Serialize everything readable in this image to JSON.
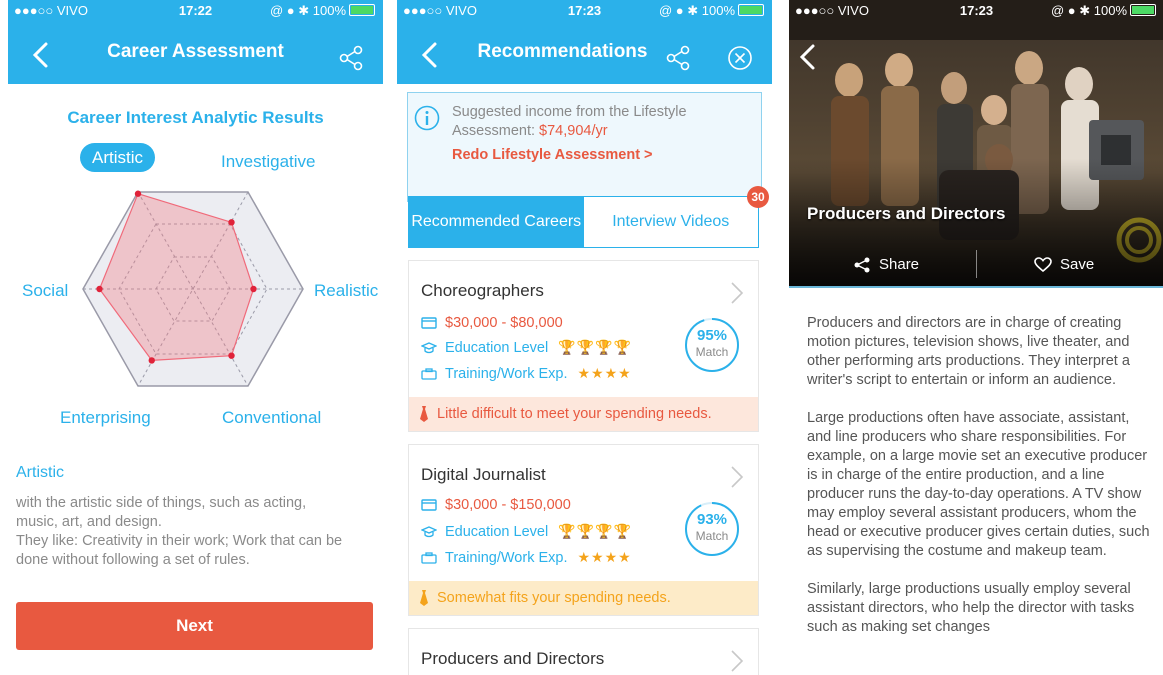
{
  "status1": {
    "carrier": "●●●○○ VIVO ",
    "time": "17:22",
    "battery": "100%"
  },
  "status2": {
    "carrier": "●●●○○ VIVO ",
    "time": "17:23",
    "battery": "100%"
  },
  "status3": {
    "carrier": "●●●○○ VIVO ",
    "time": "17:23",
    "battery": "100%"
  },
  "screen1": {
    "title": "Career Assessment",
    "heading": "Career Interest Analytic Results",
    "labels": {
      "artistic": "Artistic",
      "investigative": "Investigative",
      "realistic": "Realistic",
      "conventional": "Conventional",
      "enterprising": "Enterprising",
      "social": "Social"
    },
    "radar_values": {
      "artistic": 1.0,
      "investigative": 0.7,
      "realistic": 0.55,
      "conventional": 0.7,
      "enterprising": 0.75,
      "social": 0.85
    },
    "section_title": "Artistic",
    "description_line1": "with the artistic side of things, such as acting,",
    "description_line2": "music, art, and design.",
    "description_line3": "They like: Creativity in their work; Work that can be",
    "description_line4": "done without following a set of rules.",
    "next_label": "Next"
  },
  "screen2": {
    "title": "Recommendations",
    "info_line1": "Suggested income from the Lifestyle",
    "info_line2_prefix": "Assessment: ",
    "info_income": "$74,904/yr",
    "info_redo": "Redo Lifestyle Assessment >",
    "tab_active": "Recommended Careers",
    "tab_inactive": "Interview Videos",
    "badge": "30",
    "cards": [
      {
        "title": "Choreographers",
        "salary": "$30,000 - $80,000",
        "education": "Education Level",
        "training": "Training/Work Exp.",
        "match": "95%",
        "match_label": "Match",
        "match_value": 0.95,
        "fit": "Little difficult to meet your spending needs.",
        "trophies": 4,
        "stars": 4
      },
      {
        "title": "Digital Journalist",
        "salary": "$30,000 - $150,000",
        "education": "Education Level",
        "training": "Training/Work Exp.",
        "match": "93%",
        "match_label": "Match",
        "match_value": 0.93,
        "fit": "Somewhat fits your spending needs.",
        "trophies": 4,
        "stars": 4
      },
      {
        "title": "Producers and Directors"
      }
    ],
    "colors": {
      "accent": "#2bb1ea",
      "alert": "#e85940",
      "gold": "#f4a31b"
    }
  },
  "screen3": {
    "hero_title": "Producers and Directors",
    "share_label": "Share",
    "save_label": "Save",
    "para1": "Producers and directors are in charge of creating motion pictures, television shows, live theater, and other performing arts productions. They interpret a writer's script to entertain or inform an audience.",
    "para2": "Large productions often have associate, assistant, and line producers who share responsibilities. For example, on a large movie set an executive producer is in charge of the entire production, and a line producer runs the day-to-day operations. A TV show may employ several assistant producers, whom the head or executive producer gives certain duties, such as supervising the costume and makeup team.",
    "para3": "Similarly, large productions usually employ several assistant directors, who help the director with tasks such as making set changes"
  }
}
